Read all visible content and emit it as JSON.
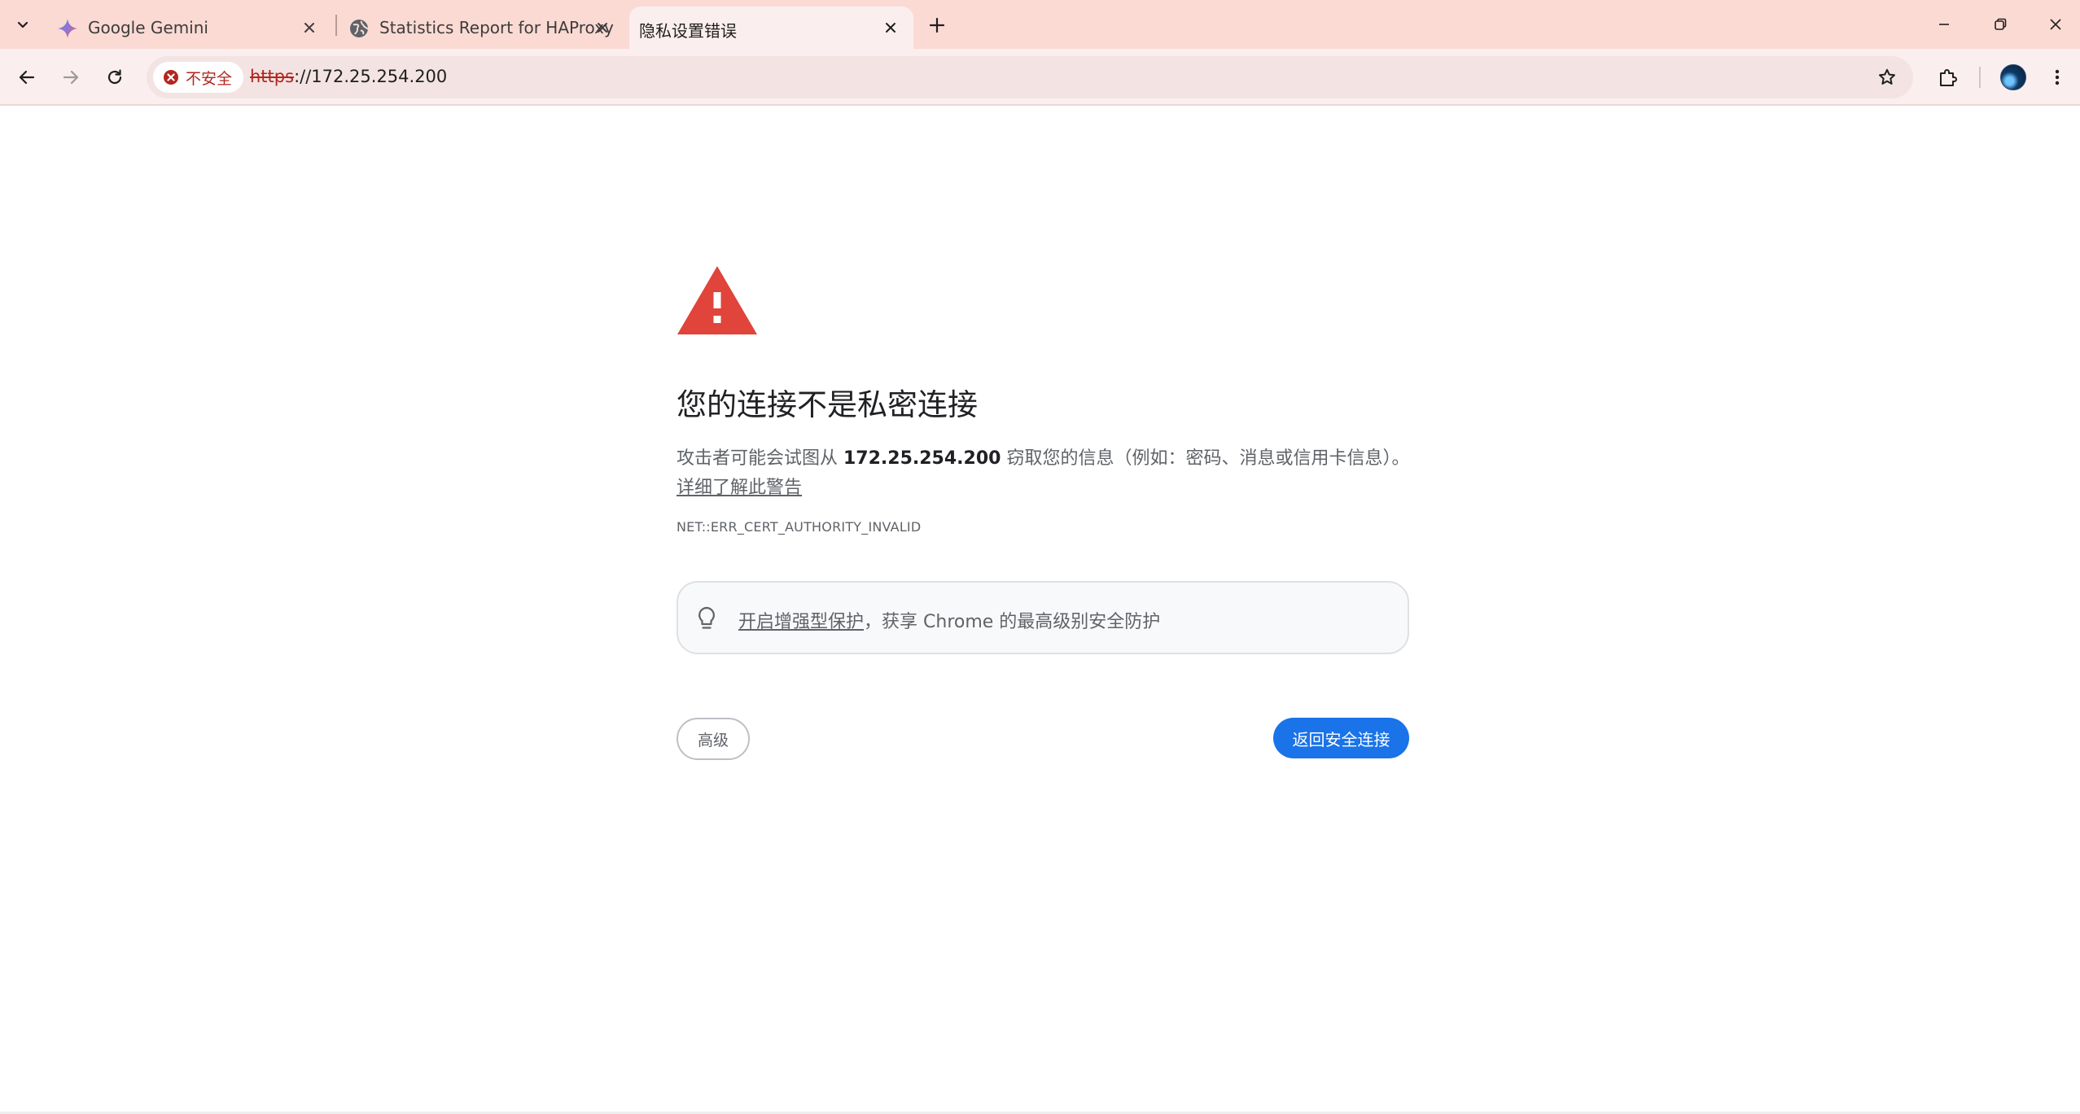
{
  "browser": {
    "tabs": [
      {
        "title": "Google Gemini",
        "favicon": "gemini-sparkle-icon",
        "active": false
      },
      {
        "title": "Statistics Report for HAProxy",
        "favicon": "globe-icon",
        "active": false
      },
      {
        "title": "隐私设置错误",
        "favicon": "",
        "active": true
      }
    ],
    "address_bar": {
      "security_label": "不安全",
      "url_scheme": "https",
      "url_rest": "://172.25.254.200"
    },
    "colors": {
      "tabstrip_bg": "#fbdad4",
      "toolbar_bg": "#fbeeee",
      "insecure_red": "#b3261e"
    }
  },
  "interstitial": {
    "heading": "您的连接不是私密连接",
    "explanation_pre": "攻击者可能会试图从 ",
    "explanation_host": "172.25.254.200",
    "explanation_post": " 窃取您的信息（例如：密码、消息或信用卡信息）。",
    "learn_more": "详细了解此警告",
    "error_code": "NET::ERR_CERT_AUTHORITY_INVALID",
    "promo_link": "开启增强型保护",
    "promo_rest": "，获享 Chrome 的最高级别安全防护",
    "advanced_button": "高级",
    "back_button": "返回安全连接",
    "colors": {
      "warning_red": "#e0443a",
      "primary_blue": "#1a73e8"
    }
  }
}
